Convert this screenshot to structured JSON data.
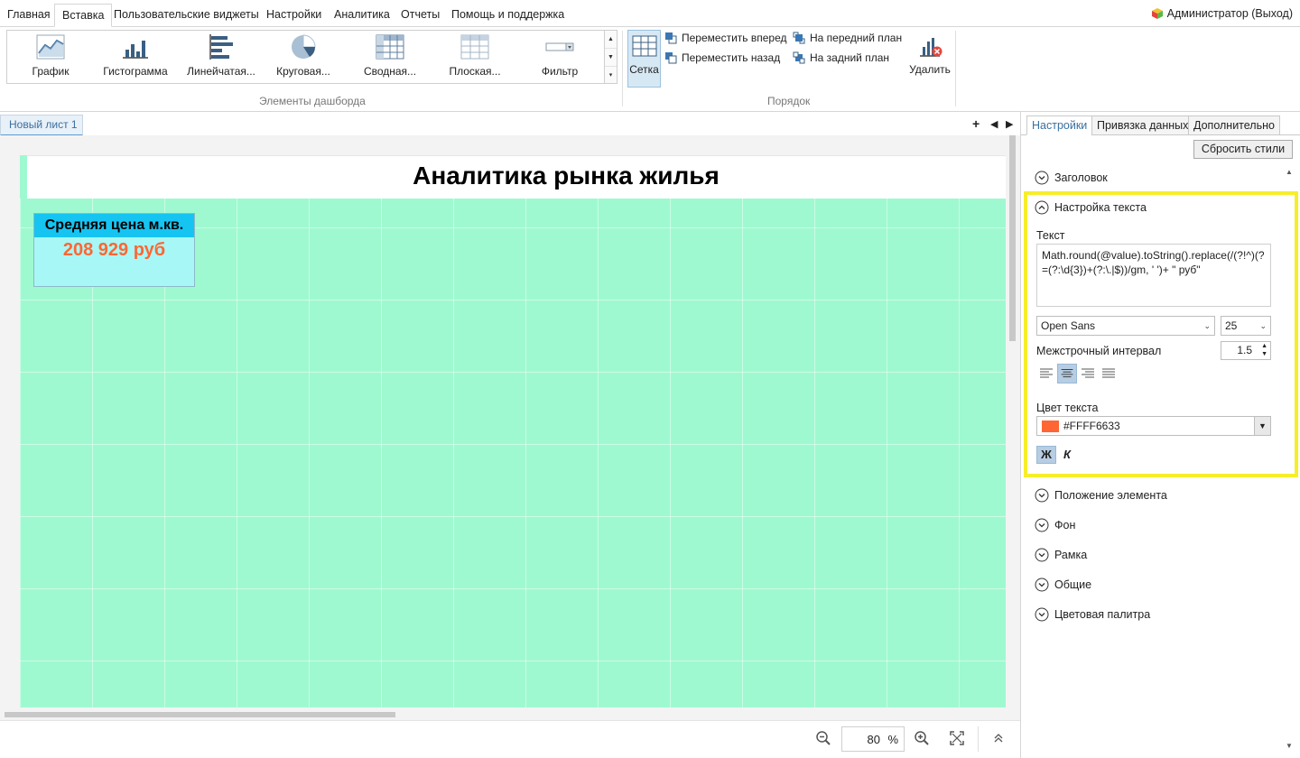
{
  "menu": {
    "items": [
      "Главная",
      "Вставка",
      "Пользовательские виджеты",
      "Настройки",
      "Аналитика",
      "Отчеты",
      "Помощь и поддержка"
    ],
    "active_index": 1,
    "admin_label": "Администратор (Выход)"
  },
  "ribbon": {
    "gallery_items": [
      {
        "label": "График",
        "icon": "line-chart-icon"
      },
      {
        "label": "Гистограмма",
        "icon": "histogram-icon"
      },
      {
        "label": "Линейчатая...",
        "icon": "bar-chart-icon"
      },
      {
        "label": "Круговая...",
        "icon": "pie-chart-icon"
      },
      {
        "label": "Сводная...",
        "icon": "pivot-table-icon"
      },
      {
        "label": "Плоская...",
        "icon": "flat-table-icon"
      },
      {
        "label": "Фильтр",
        "icon": "filter-icon"
      }
    ],
    "group_elements_label": "Элементы дашборда",
    "grid_button_label": "Сетка",
    "order": {
      "bring_forward": "Переместить вперед",
      "send_backward": "Переместить назад",
      "bring_to_front": "На передний план",
      "send_to_back": "На задний план"
    },
    "delete_label": "Удалить",
    "group_order_label": "Порядок"
  },
  "sheets": {
    "tabs": [
      "Новый лист 1"
    ]
  },
  "canvas": {
    "title": "Аналитика рынка жилья",
    "kpi": {
      "header": "Средняя цена м.кв.",
      "value": "208 929 руб"
    },
    "colors": {
      "background": "#9FF9D0",
      "kpi_header": "#16C4F2",
      "kpi_value": "#FF6633"
    }
  },
  "zoom": {
    "value": "80",
    "unit": "%"
  },
  "panel": {
    "tabs": [
      "Настройки",
      "Привязка данных",
      "Дополнительно"
    ],
    "active_tab": 0,
    "reset_button": "Сбросить стили",
    "sections": {
      "header": "Заголовок",
      "text_settings": "Настройка текста",
      "element_position": "Положение элемента",
      "background": "Фон",
      "border": "Рамка",
      "general": "Общие",
      "color_palette": "Цветовая палитра"
    },
    "text_settings": {
      "text_label": "Текст",
      "text_value": "Math.round(@value).toString().replace(/(?!^)(?=(?:\\d{3})+(?:\\.|$))/gm, ' ')+ \" руб\"",
      "font_family": "Open Sans",
      "font_size": "25",
      "line_spacing_label": "Межстрочный интервал",
      "line_spacing": "1.5",
      "alignment": "center",
      "color_label": "Цвет текста",
      "color_value": "#FFFF6633",
      "bold_label": "Ж",
      "italic_label": "К"
    }
  }
}
